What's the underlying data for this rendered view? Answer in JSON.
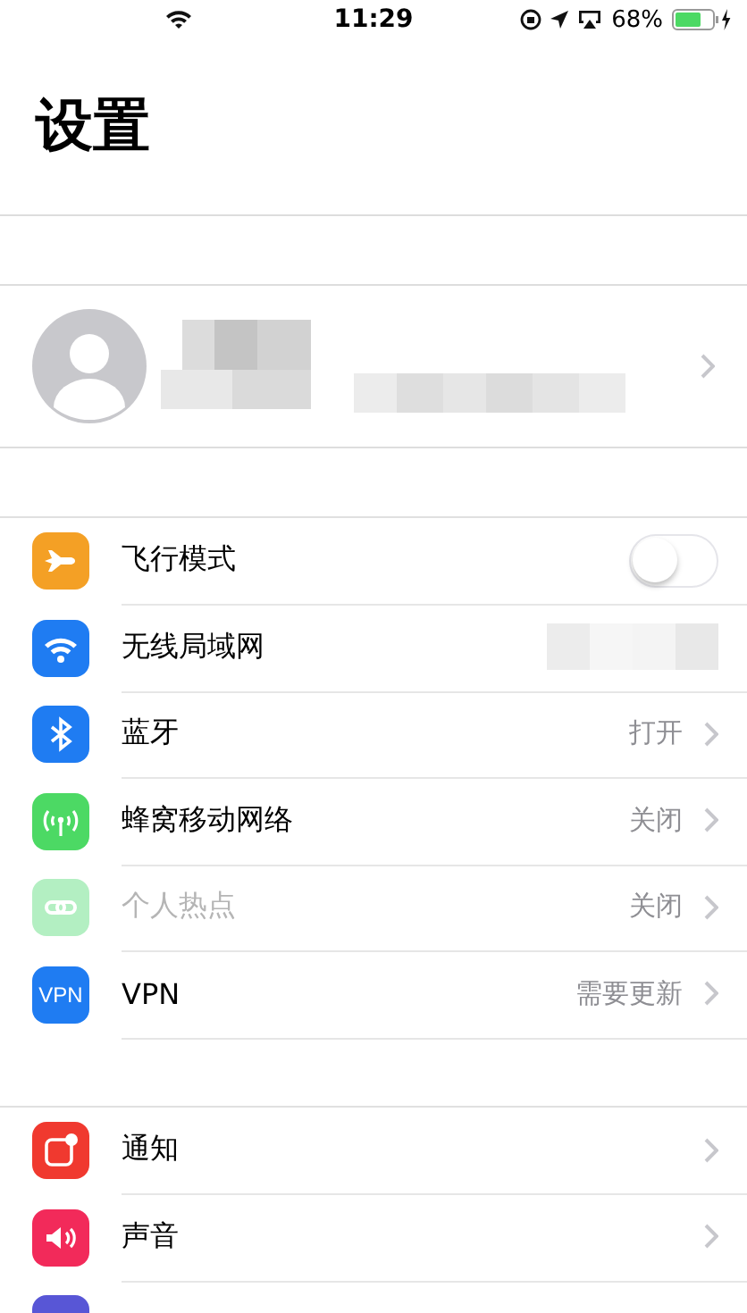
{
  "status_bar": {
    "time": "11:29",
    "battery": "68%"
  },
  "title": "设置",
  "profile": {
    "kind": "blurred"
  },
  "groups": [
    {
      "rows": [
        {
          "kind": "toggle",
          "label": "飞行模式",
          "color": "#f4a025",
          "on": false
        },
        {
          "kind": "blurred",
          "label": "无线局域网",
          "color": "#1f7cf2"
        },
        {
          "kind": "detail",
          "label": "蓝牙",
          "value": "打开",
          "color": "#1f7cf2"
        },
        {
          "kind": "detail",
          "label": "蜂窝移动网络",
          "value": "关闭",
          "color": "#4cd964"
        },
        {
          "kind": "detail",
          "label": "个人热点",
          "value": "关闭",
          "color": "#b3efc2",
          "disabled": true
        },
        {
          "kind": "detail",
          "label": "VPN",
          "value": "需要更新",
          "color": "#1f7cf2",
          "icon_text": "VPN"
        }
      ]
    },
    {
      "rows": [
        {
          "kind": "detail",
          "label": "通知",
          "color": "#f0392f"
        },
        {
          "kind": "detail",
          "label": "声音",
          "color": "#f22a5a"
        },
        {
          "kind": "cut",
          "color": "#5856d6"
        }
      ]
    }
  ]
}
